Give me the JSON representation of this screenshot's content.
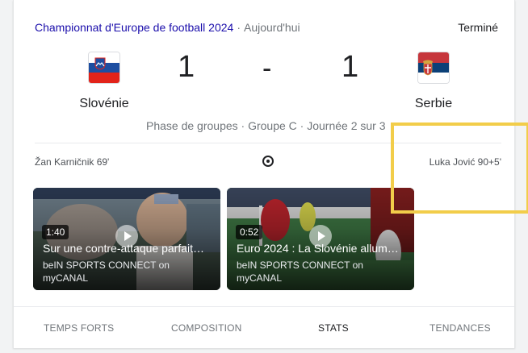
{
  "header": {
    "competition": "Championnat d'Europe de football 2024",
    "separator": "·",
    "day": "Aujourd'hui",
    "status": "Terminé"
  },
  "match": {
    "home": {
      "name": "Slovénie",
      "score": "1",
      "flag_icon": "slovenia-flag-icon",
      "colors": [
        "#ffffff",
        "#1d4ea1",
        "#e2231a"
      ]
    },
    "away": {
      "name": "Serbie",
      "score": "1",
      "flag_icon": "serbia-flag-icon",
      "colors": [
        "#c6363c",
        "#0c4077",
        "#ffffff"
      ]
    },
    "dash": "-",
    "phase": "Phase de groupes · Groupe C · Journée 2 sur 3"
  },
  "goals": {
    "home_scorer": "Žan Karničnik 69'",
    "away_scorer": "Luka Jović 90+5'",
    "ball_icon": "football-icon"
  },
  "videos": [
    {
      "duration": "1:40",
      "title": "Sur une contre-attaque parfait…",
      "source": "beIN SPORTS CONNECT on myCANAL"
    },
    {
      "duration": "0:52",
      "title": "Euro 2024 : La Slovénie allum…",
      "source": "beIN SPORTS CONNECT on myCANAL"
    }
  ],
  "tabs": [
    {
      "label": "TEMPS FORTS",
      "active": false
    },
    {
      "label": "COMPOSITION",
      "active": false
    },
    {
      "label": "STATS",
      "active": true
    },
    {
      "label": "TENDANCES",
      "active": false
    }
  ],
  "accent": "#f2cd4a"
}
